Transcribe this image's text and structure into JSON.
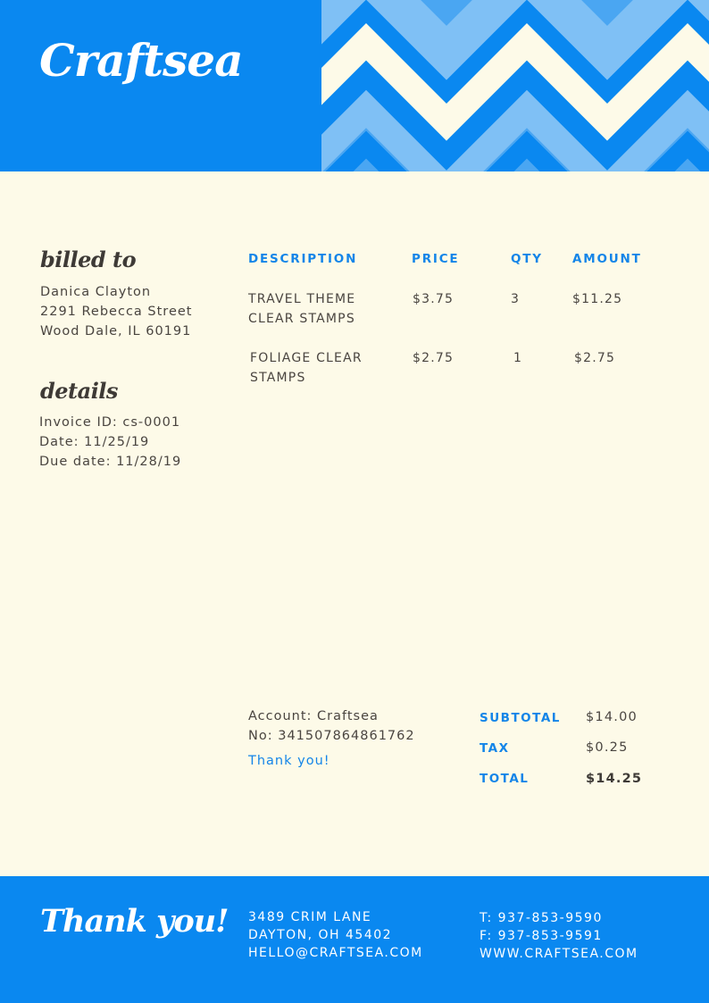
{
  "brand": {
    "name": "Craftsea"
  },
  "colors": {
    "accent": "#0a88f0",
    "background": "#fdfae8",
    "chevron_light": "#7fc0f5",
    "chevron_mid": "#4aa6f2",
    "chevron_cream": "#fdfae8"
  },
  "billed_to": {
    "title": "billed to",
    "lines": [
      "Danica Clayton",
      "2291 Rebecca Street",
      "Wood Dale, IL 60191"
    ]
  },
  "details": {
    "title": "details",
    "lines": [
      "Invoice ID: cs-0001",
      "Date: 11/25/19",
      "Due date: 11/28/19"
    ]
  },
  "table": {
    "headers": {
      "description": "DESCRIPTION",
      "price": "PRICE",
      "qty": "QTY",
      "amount": "AMOUNT"
    },
    "rows": [
      {
        "description_1": "TRAVEL THEME",
        "description_2": "CLEAR STAMPS",
        "price": "$3.75",
        "qty": "3",
        "amount": "$11.25"
      },
      {
        "description_1": "FOLIAGE CLEAR",
        "description_2": "STAMPS",
        "price": "$2.75",
        "qty": "1",
        "amount": "$2.75"
      }
    ]
  },
  "account": {
    "line1": "Account: Craftsea",
    "line2": "No: 341507864861762",
    "thanks": "Thank you!"
  },
  "totals": {
    "subtotal_label": "SUBTOTAL",
    "subtotal": "$14.00",
    "tax_label": "TAX",
    "tax": "$0.25",
    "total_label": "TOTAL",
    "total": "$14.25"
  },
  "footer": {
    "thanks": "Thank you!",
    "address": [
      "3489 CRIM LANE",
      "DAYTON, OH 45402",
      "HELLO@CRAFTSEA.COM"
    ],
    "contact": [
      "T: 937-853-9590",
      "F: 937-853-9591",
      "WWW.CRAFTSEA.COM"
    ]
  }
}
